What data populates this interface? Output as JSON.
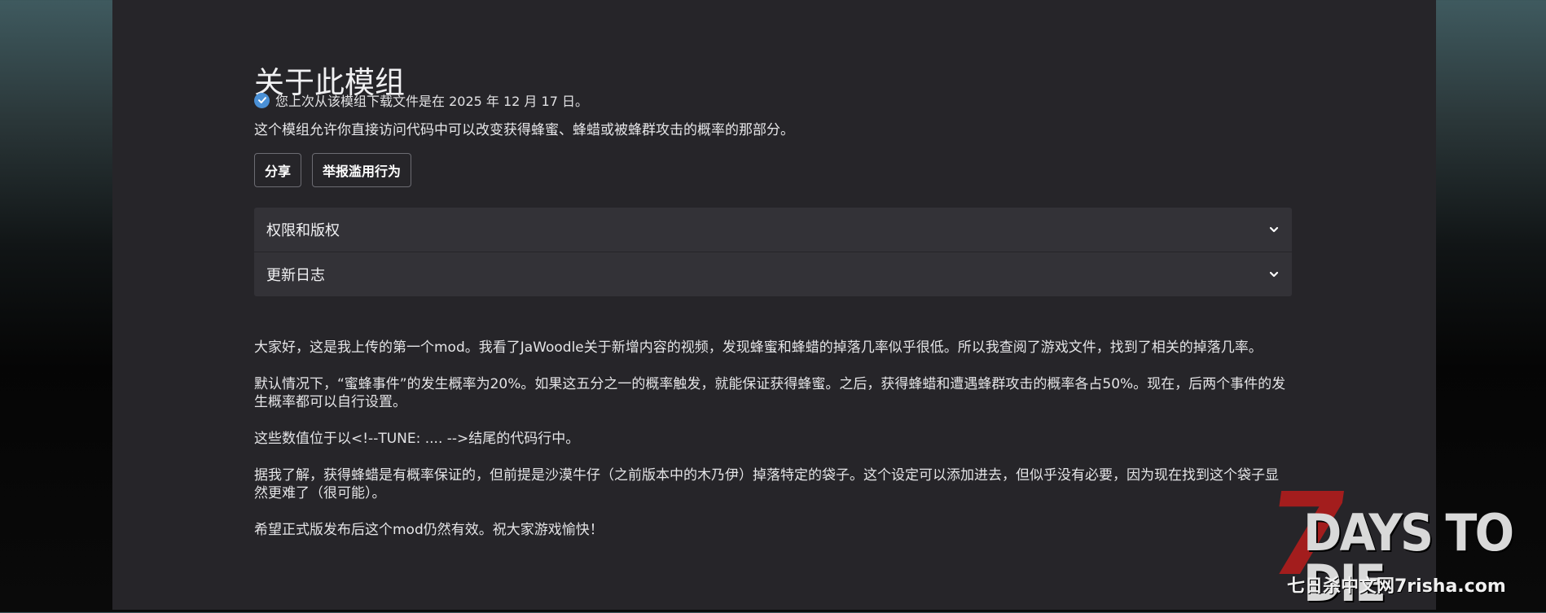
{
  "mod": {
    "title": "关于此模组",
    "download_note": "您上次从该模组下载文件是在 2025 年 12 月 17 日。",
    "summary": "这个模组允许你直接访问代码中可以改变获得蜂蜜、蜂蜡或被蜂群攻击的概率的那部分。"
  },
  "actions": {
    "share": "分享",
    "report": "举报滥用行为"
  },
  "accordion": {
    "permissions": "权限和版权",
    "changelog": "更新日志"
  },
  "description": {
    "p1": "大家好，这是我上传的第一个mod。我看了JaWoodle关于新增内容的视频，发现蜂蜜和蜂蜡的掉落几率似乎很低。所以我查阅了游戏文件，找到了相关的掉落几率。",
    "p2": "默认情况下，“蜜蜂事件”的发生概率为20%。如果这五分之一的概率触发，就能保证获得蜂蜜。之后，获得蜂蜡和遭遇蜂群攻击的概率各占50%。现在，后两个事件的发生概率都可以自行设置。",
    "p3": "这些数值位于以<!--TUNE: .... -->结尾的代码行中。",
    "p4": "据我了解，获得蜂蜡是有概率保证的，但前提是沙漠牛仔（之前版本中的木乃伊）掉落特定的袋子。这个设定可以添加进去，但似乎没有必要，因为现在找到这个袋子显然更难了（很可能）。",
    "p5": "希望正式版发布后这个mod仍然有效。祝大家游戏愉快！"
  },
  "watermark": {
    "seven": "7",
    "title": "DAYS TO DIE",
    "site": "七日杀中文网7risha.com"
  },
  "colors": {
    "panel": "#262529",
    "accordion_bg": "#333237",
    "check_blue": "#4a90d6",
    "logo_red": "#a31d1d"
  }
}
